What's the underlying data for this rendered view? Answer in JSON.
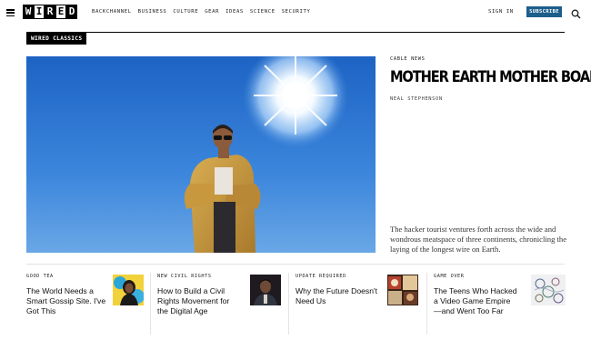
{
  "header": {
    "logo_letters": [
      "W",
      "I",
      "R",
      "E",
      "D"
    ],
    "nav": [
      "Backchannel",
      "Business",
      "Culture",
      "Gear",
      "Ideas",
      "Science",
      "Security"
    ],
    "sign_in": "SIGN IN",
    "subscribe": "SUBSCRIBE",
    "brand_color": "#1c5f8c"
  },
  "section": {
    "label": "WIRED CLASSICS"
  },
  "hero": {
    "kicker": "CABLE NEWS",
    "title": "MOTHER EARTH MOTHER BOARD",
    "author": "NEAL STEPHENSON",
    "dek": "The hacker tourist ventures forth across the wide and wondrous meatspace of three continents, chronicling the laying of the longest wire on Earth."
  },
  "stories": [
    {
      "kicker": "GOOD TEA",
      "title": "The World Needs a Smart Gossip Site. I've Got This"
    },
    {
      "kicker": "NEW CIVIL RIGHTS",
      "title": "How to Build a Civil Rights Movement for the Digital Age"
    },
    {
      "kicker": "UPDATE REQUIRED",
      "title": "Why the Future Doesn't Need Us"
    },
    {
      "kicker": "GAME OVER",
      "title": "The Teens Who Hacked a Video Game Empire—and Went Too Far"
    }
  ]
}
